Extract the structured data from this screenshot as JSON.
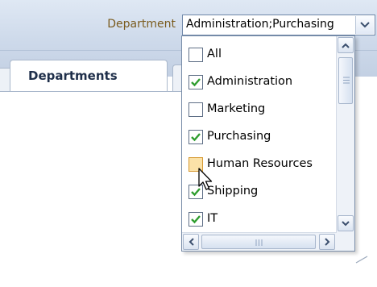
{
  "department_filter": {
    "label": "Department",
    "value": "Administration;Purchasing",
    "options": [
      {
        "label": "All",
        "checked": false,
        "hover": false
      },
      {
        "label": "Administration",
        "checked": true,
        "hover": false
      },
      {
        "label": "Marketing",
        "checked": false,
        "hover": false
      },
      {
        "label": "Purchasing",
        "checked": true,
        "hover": false
      },
      {
        "label": "Human Resources",
        "checked": false,
        "hover": true
      },
      {
        "label": "Shipping",
        "checked": true,
        "hover": false
      },
      {
        "label": "IT",
        "checked": true,
        "hover": false
      }
    ]
  },
  "tabs": [
    {
      "label": "Departments",
      "active": true
    }
  ],
  "colors": {
    "check": "#2e9d2e",
    "label_text": "#7a5b1e",
    "header_bg": "#cdd9ea",
    "hover_box": "#fbe2a8"
  },
  "icons": {
    "combo_arrow": "chevron-down-icon",
    "scroll_up": "chevron-up-icon",
    "scroll_down": "chevron-down-icon",
    "scroll_left": "chevron-left-icon",
    "scroll_right": "chevron-right-icon",
    "checkbox_mark": "check-icon",
    "pointer": "mouse-pointer-icon"
  }
}
